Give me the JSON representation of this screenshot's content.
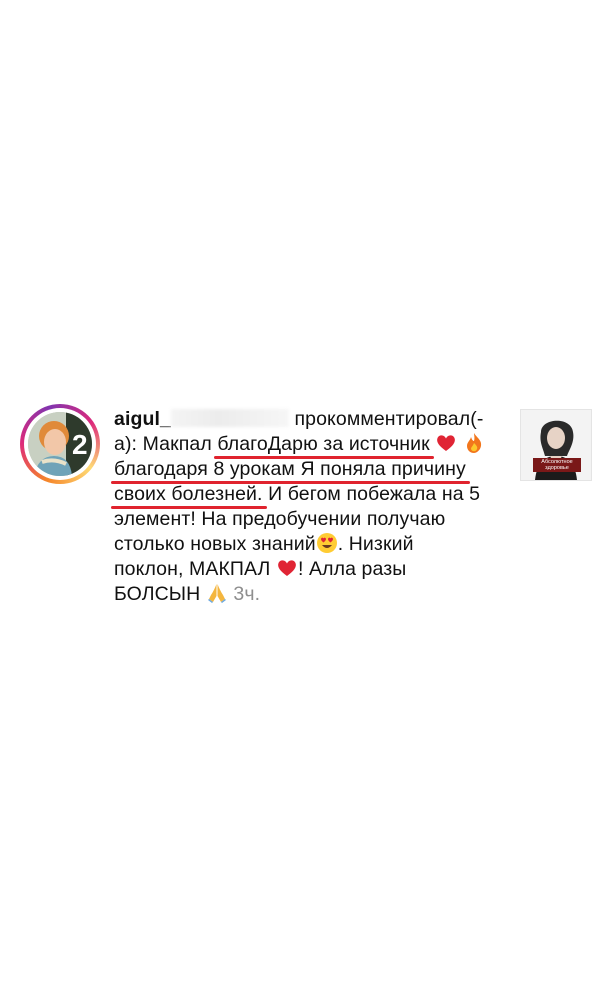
{
  "comment": {
    "username": "aigul_",
    "action_text": "прокомментировал(-",
    "line2_prefix": "а): Макпал ",
    "line2_underlined": "благоДарю за источник",
    "line3_underlined": "благодаря 8 урокам Я поняла причину",
    "line4_underlined": "своих болезней.",
    "line4_rest": " И бегом побежала на 5",
    "line5": "элемент! На предобучении получаю",
    "line6": "столько новых знаний",
    "line6_rest": ". Низкий",
    "line7": "поклон, МАКПАЛ ",
    "line7_rest": "! Алла разы",
    "line8": "БОЛСЫН ",
    "time": "3ч."
  },
  "avatar": {
    "badge_text": "2"
  },
  "thumbnail": {
    "caption": "Абсолютное здоровье"
  },
  "colors": {
    "underline": "#e0232e",
    "time": "#8e8e8e",
    "heart": "#e02434"
  },
  "icons": [
    "heart-emoji",
    "fire-emoji",
    "heart-eyes-emoji",
    "praying-hands-emoji"
  ]
}
